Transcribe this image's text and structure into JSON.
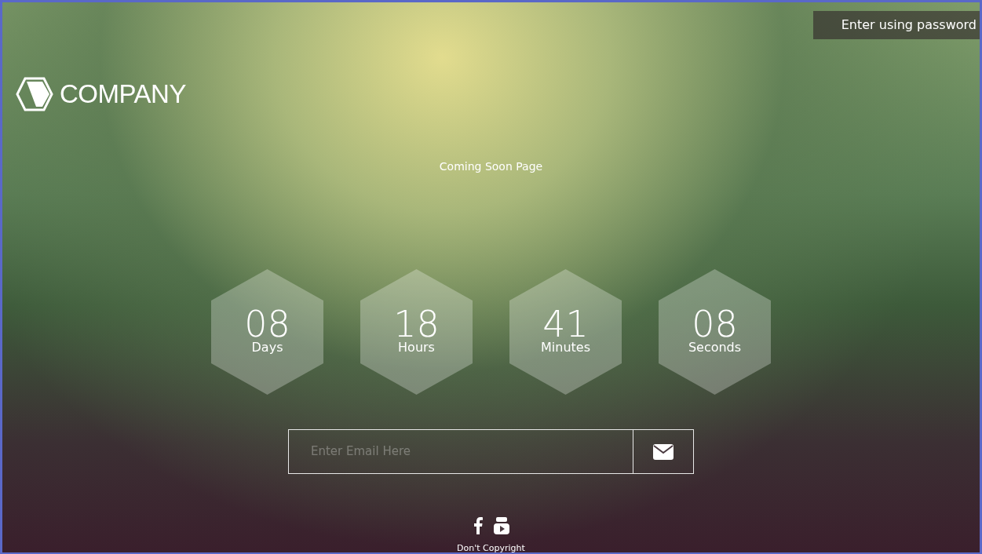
{
  "top_link": "Enter using password",
  "brand": "COMPANY",
  "headline": "Coming Soon Page",
  "countdown": [
    {
      "value": "08",
      "label": "Days"
    },
    {
      "value": "18",
      "label": "Hours"
    },
    {
      "value": "41",
      "label": "Minutes"
    },
    {
      "value": "08",
      "label": "Seconds"
    }
  ],
  "subscribe": {
    "placeholder": "Enter Email Here"
  },
  "footer": {
    "copyright": "Don't Copyright"
  }
}
